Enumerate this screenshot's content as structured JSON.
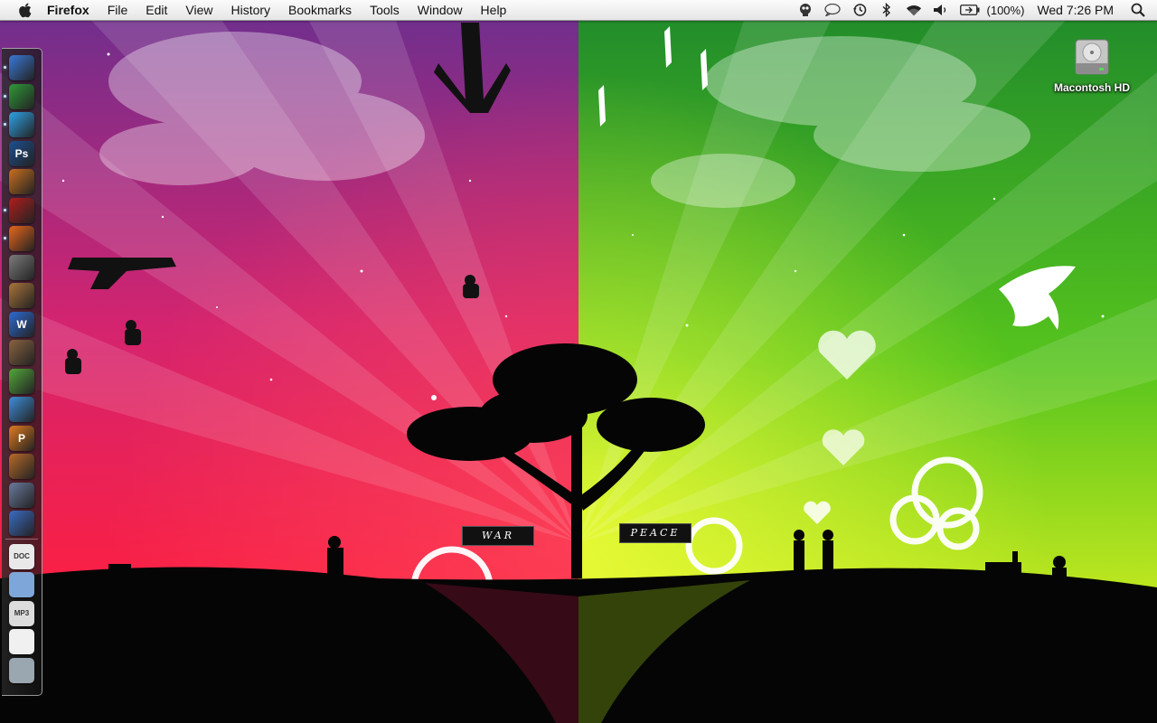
{
  "menubar": {
    "app_name": "Firefox",
    "items": [
      "File",
      "Edit",
      "View",
      "History",
      "Bookmarks",
      "Tools",
      "Window",
      "Help"
    ],
    "status": {
      "battery_percent": "(100%)",
      "clock": "Wed 7:26 PM",
      "icons": [
        "alien-icon",
        "speech-bubble-icon",
        "time-machine-icon",
        "bluetooth-icon",
        "wifi-icon",
        "volume-icon",
        "battery-icon",
        "spotlight-icon"
      ]
    }
  },
  "desktop": {
    "hd_label": "Macontosh HD"
  },
  "dock": {
    "apps": [
      {
        "name": "finder",
        "label": "",
        "color": "#3a79d6",
        "running": true
      },
      {
        "name": "adium",
        "label": "",
        "color": "#2e9a3a",
        "running": true
      },
      {
        "name": "itunes",
        "label": "",
        "color": "#2fa3e6",
        "running": true
      },
      {
        "name": "photoshop",
        "label": "Ps",
        "color": "#1d4f8f",
        "running": false
      },
      {
        "name": "garageband",
        "label": "",
        "color": "#c8701e",
        "running": false
      },
      {
        "name": "system-monitor",
        "label": "",
        "color": "#b21d1d",
        "running": true
      },
      {
        "name": "firefox",
        "label": "",
        "color": "#e8661b",
        "running": true
      },
      {
        "name": "system-preferences",
        "label": "",
        "color": "#7c7c7c",
        "running": false
      },
      {
        "name": "iphoto",
        "label": "",
        "color": "#a9743a",
        "running": false
      },
      {
        "name": "word",
        "label": "W",
        "color": "#2d6bd3",
        "running": false
      },
      {
        "name": "address-book",
        "label": "",
        "color": "#8a6340",
        "running": false
      },
      {
        "name": "chat",
        "label": "",
        "color": "#52a83a",
        "running": false
      },
      {
        "name": "safari",
        "label": "",
        "color": "#3c8fd8",
        "running": false
      },
      {
        "name": "powerpoint",
        "label": "P",
        "color": "#e07b1f",
        "running": false
      },
      {
        "name": "mac-app",
        "label": "",
        "color": "#b86a2a",
        "running": false
      },
      {
        "name": "compressor",
        "label": "",
        "color": "#6a7a9c",
        "running": false
      },
      {
        "name": "chart-app",
        "label": "",
        "color": "#3b6cc4",
        "running": false
      }
    ],
    "stacks": [
      {
        "name": "document-stack",
        "label": "DOC",
        "color": "#e9e9e9"
      },
      {
        "name": "folder-stack",
        "label": "",
        "color": "#7fa6d8"
      },
      {
        "name": "music-stack",
        "label": "MP3",
        "color": "#dcdcdc"
      },
      {
        "name": "firefox-download-stack",
        "label": "",
        "color": "#f0f0f0"
      },
      {
        "name": "trash",
        "label": "",
        "color": "#9aa6b0"
      }
    ]
  },
  "scene": {
    "left_sign": "WAR",
    "right_sign": "PEACE"
  }
}
